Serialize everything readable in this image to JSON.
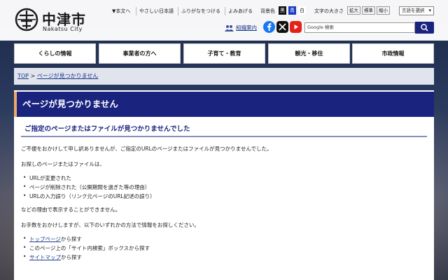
{
  "site": {
    "name": "中津市",
    "name_en": "Nakatsu City"
  },
  "utility": {
    "main_content": "本文へ",
    "easy_japanese": "やさしい日本語",
    "furigana": "ふりがなをつける",
    "read_aloud": "よみあげる",
    "bg_color_label": "背景色",
    "bg_black": "黒",
    "bg_blue": "青",
    "bg_white": "白",
    "font_size_label": "文字の大きさ",
    "size_large": "拡大",
    "size_standard": "標準",
    "size_small": "縮小",
    "language_select": "言語を選択",
    "org_guide": "組織案内",
    "search_placeholder": "Google 検索"
  },
  "nav": [
    "くらしの情報",
    "事業者の方へ",
    "子育て・教育",
    "観光・移住",
    "市政情報"
  ],
  "breadcrumb": {
    "top": "TOP",
    "separator": ">",
    "current": "ページが見つかりません"
  },
  "page": {
    "title": "ページが見つかりません",
    "subtitle": "ご指定のページまたはファイルが見つかりませんでした",
    "p1": "ご不便をおかけして申し訳ありませんが、ご指定のURLのページまたはファイルが見つかりませんでした。",
    "p2": "お探しのページまたはファイルは、",
    "reasons": [
      "URLが変更された",
      "ページが削除された（公開期間を過ぎた等の理由）",
      "URLの入力誤り（リンク元ページのURL記述の誤り）"
    ],
    "p3": "などの理由で表示することができません。",
    "p4": "お手数をおかけしますが、以下のいずれかの方法で情報をお探しください。",
    "method1_link": "トップページ",
    "method1_rest": "から探す",
    "method2": "このページ上の「サイト内検索」ボックスから探す",
    "method3_link": "サイトマップ",
    "method3_rest": "から探す"
  },
  "colors": {
    "brand_navy": "#1a237e",
    "accent_orange": "#f0a868",
    "link": "#1a3a8a"
  },
  "icons": [
    "city-emblem-icon",
    "arrow-down-icon",
    "people-icon",
    "facebook-icon",
    "x-icon",
    "youtube-icon",
    "search-icon"
  ]
}
